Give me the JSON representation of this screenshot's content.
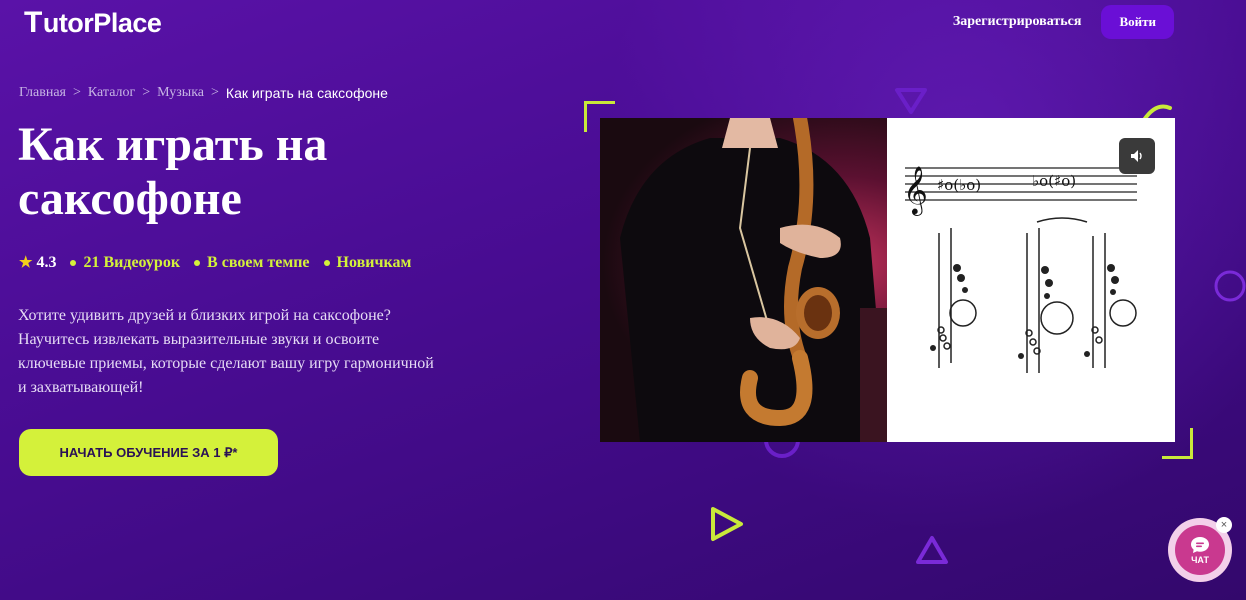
{
  "header": {
    "logo_mark": "T",
    "logo_rest": "utorPlace",
    "register_label": "Зарегистрироваться",
    "login_label": "Войти"
  },
  "breadcrumb": {
    "items": [
      "Главная",
      "Каталог",
      "Музыка"
    ],
    "separator": ">",
    "current": "Как играть на саксофоне"
  },
  "hero": {
    "title": "Как играть на саксофоне",
    "rating": "4.3",
    "meta": [
      "21 Видеоурок",
      "В своем темпе",
      "Новичкам"
    ],
    "description": "Хотите удивить друзей и близких игрой на саксофоне? Научитесь извлекать выразительные звуки и освоите ключевые приемы, которые сделают вашу игру гармоничной и захватывающей!",
    "cta_label": "НАЧАТЬ ОБУЧЕНИЕ ЗА 1 ₽*"
  },
  "video": {
    "mute_icon": "speaker-icon"
  },
  "chat": {
    "label": "ЧАТ",
    "close_symbol": "×"
  },
  "colors": {
    "accent": "#d4f13a",
    "button_purple": "#6a0fd6",
    "background": "#4b0d96",
    "chat": "#c9398f"
  }
}
